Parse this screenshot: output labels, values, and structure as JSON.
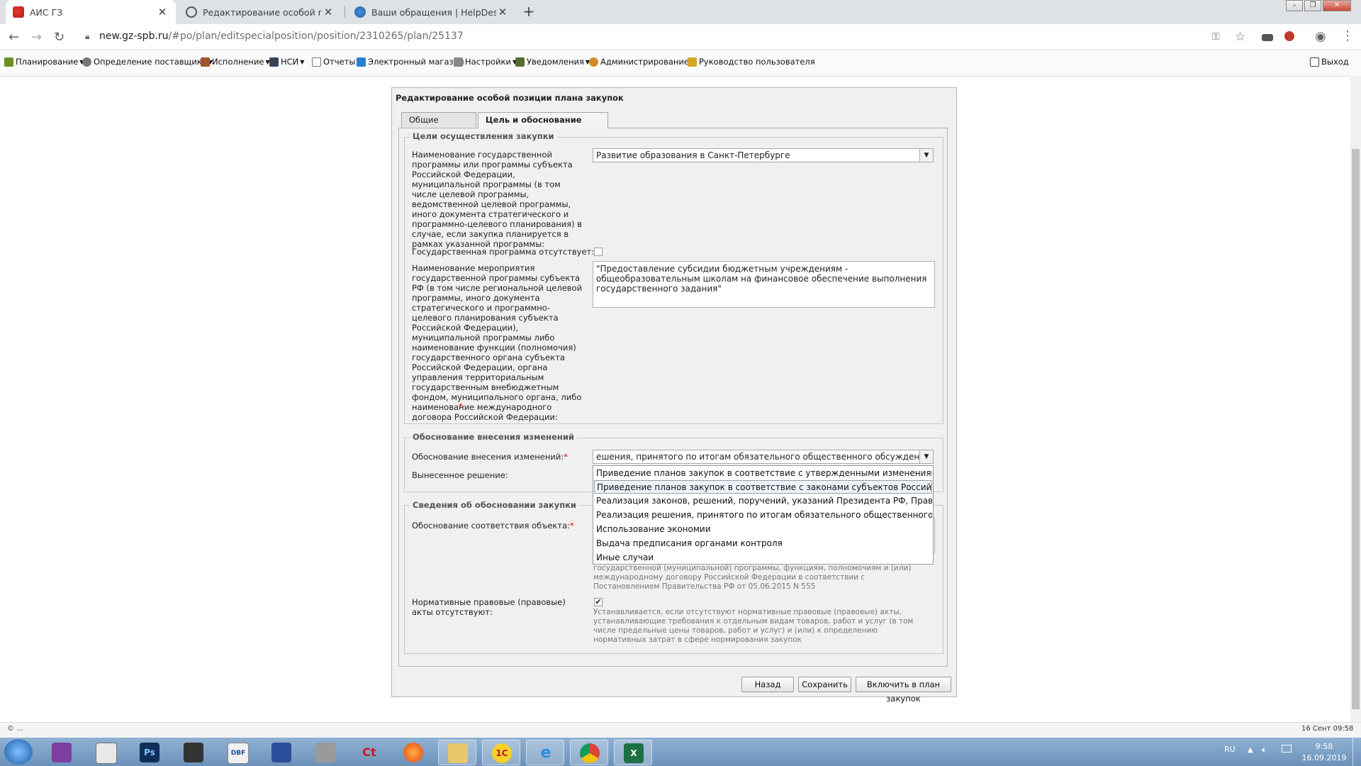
{
  "browser": {
    "tabs": [
      {
        "title": "АИС ГЗ",
        "active": true
      },
      {
        "title": "Редактирование особой позиц",
        "active": false
      },
      {
        "title": "Ваши обращения | HelpDesk - с",
        "active": false
      }
    ],
    "url_host": "new.gz-spb.ru",
    "url_path": "/#po/plan/editspecialposition/position/2310265/plan/25137"
  },
  "menu": {
    "items": [
      "Планирование",
      "Определение поставщика",
      "Исполнение",
      "НСИ",
      "Отчеты",
      "Электронный магазин",
      "Настройки",
      "Уведомления",
      "Администрирование",
      "Руководство пользователя"
    ],
    "logout": "Выход"
  },
  "panel": {
    "title": "Редактирование особой позиции плана закупок",
    "tabs": [
      "Общие сведения",
      "Цель и обоснование закупки"
    ],
    "section1": {
      "legend": "Цели осуществления закупки",
      "program_label": "Наименование государственной программы или программы субъекта Российской Федерации, муниципальной программы (в том числе целевой программы, ведомственной целевой программы, иного документа стратегического и программно-целевого планирования) в случае, если закупка планируется в рамках указанной программы:",
      "program_value": "Развитие образования в Санкт-Петербурге",
      "no_program_label": "Государственная программа отсутствует:",
      "event_label": "Наименование мероприятия государственной программы субъекта РФ (в том числе региональной целевой программы, иного документа стратегического и программно-целевого планирования субъекта Российской Федерации), муниципальной программы либо наименование функции (полномочия) государственного органа субъекта Российской Федерации, органа управления территориальным государственным внебюджетным фондом, муниципального органа, либо наименование международного договора Российской Федерации:",
      "event_value": "\"Предоставление субсидии бюджетным учреждениям - общеобразовательным школам на финансовое обеспечение выполнения государственного задания\""
    },
    "section2": {
      "legend": "Обоснование внесения изменений",
      "reason_label": "Обоснование внесения изменений:",
      "reason_value": "ешения, принятого по итогам обязательного общественного обсуждения закупок",
      "decision_label": "Вынесенное решение:",
      "options": [
        "Приведение планов закупок в соответствие с утвержденными изменениями целей...",
        "Приведение планов закупок в соответствие с законами субъектов Российской Фед...",
        "Реализация законов, решений, поручений, указаний Президента РФ, Правительст...",
        "Реализация решения, принятого по итогам обязательного общественного обсужде...",
        "Использование экономии",
        "Выдача предписания органами контроля",
        "Иные случаи"
      ]
    },
    "section3": {
      "legend": "Сведения об обосновании закупки",
      "conform_label": "Обоснование соответствия объекта:",
      "conform_hint": "государственной (муниципальной) программы, функциям, полномочиям и (или) международному договору Российской Федерации в соответствии с Постановлением Правительства РФ от 05.06.2015 N 555",
      "acts_label": "Нормативные правовые (правовые) акты отсутствуют:",
      "acts_hint": "Устанавливается, если отсутствуют нормативные правовые (правовые) акты, устанавливающие требования к отдельным видам товаров, работ и услуг (в том числе предельные цены товаров, работ и услуг) и (или) к определению нормативных затрат в сфере нормирования закупок"
    },
    "buttons": {
      "back": "Назад",
      "save": "Сохранить",
      "include": "Включить в план закупок"
    }
  },
  "status": {
    "left": "© ...",
    "right": "16 Сент 09:58"
  },
  "taskbar": {
    "lang": "RU",
    "time": "9:58",
    "date": "16.09.2019"
  }
}
